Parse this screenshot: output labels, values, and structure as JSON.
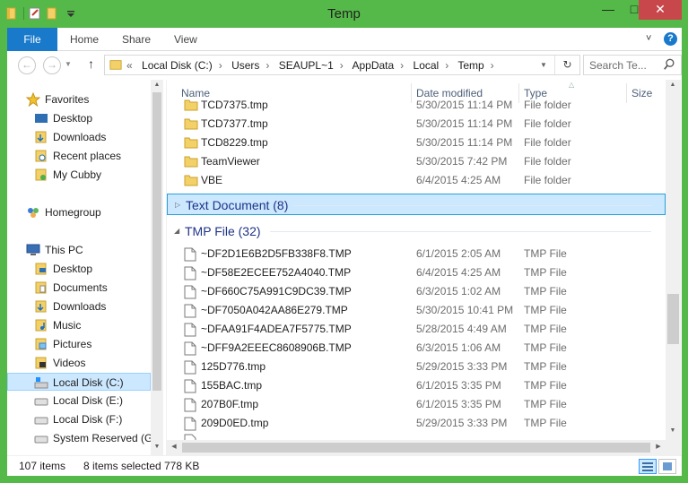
{
  "window": {
    "title": "Temp"
  },
  "ribbon": {
    "file": "File",
    "home": "Home",
    "share": "Share",
    "view": "View",
    "help": "?"
  },
  "address": {
    "crumbs": [
      "Local Disk (C:)",
      "Users",
      "SEAUPL~1",
      "AppData",
      "Local",
      "Temp"
    ],
    "search_placeholder": "Search Te..."
  },
  "nav": {
    "favorites": "Favorites",
    "desktop": "Desktop",
    "downloads": "Downloads",
    "recent": "Recent places",
    "cubby": "My Cubby",
    "homegroup": "Homegroup",
    "thispc": "This PC",
    "pc_desktop": "Desktop",
    "pc_documents": "Documents",
    "pc_downloads": "Downloads",
    "pc_music": "Music",
    "pc_pictures": "Pictures",
    "pc_videos": "Videos",
    "disk_c": "Local Disk (C:)",
    "disk_e": "Local Disk (E:)",
    "disk_f": "Local Disk (F:)",
    "sysres": "System Reserved (G:"
  },
  "columns": {
    "name": "Name",
    "date": "Date modified",
    "type": "Type",
    "size": "Size"
  },
  "folder_rows": [
    {
      "name": "TCD7375.tmp",
      "date": "5/30/2015 11:14 PM",
      "type": "File folder"
    },
    {
      "name": "TCD7377.tmp",
      "date": "5/30/2015 11:14 PM",
      "type": "File folder"
    },
    {
      "name": "TCD8229.tmp",
      "date": "5/30/2015 11:14 PM",
      "type": "File folder"
    },
    {
      "name": "TeamViewer",
      "date": "5/30/2015 7:42 PM",
      "type": "File folder"
    },
    {
      "name": "VBE",
      "date": "6/4/2015 4:25 AM",
      "type": "File folder"
    }
  ],
  "groups": {
    "text_doc": "Text Document (8)",
    "tmp_file": "TMP File (32)"
  },
  "tmp_rows": [
    {
      "name": "~DF2D1E6B2D5FB338F8.TMP",
      "date": "6/1/2015 2:05 AM",
      "type": "TMP File"
    },
    {
      "name": "~DF58E2ECEE752A4040.TMP",
      "date": "6/4/2015 4:25 AM",
      "type": "TMP File"
    },
    {
      "name": "~DF660C75A991C9DC39.TMP",
      "date": "6/3/2015 1:02 AM",
      "type": "TMP File"
    },
    {
      "name": "~DF7050A042AA86E279.TMP",
      "date": "5/30/2015 10:41 PM",
      "type": "TMP File"
    },
    {
      "name": "~DFAA91F4ADEA7F5775.TMP",
      "date": "5/28/2015 4:49 AM",
      "type": "TMP File"
    },
    {
      "name": "~DFF9A2EEEC8608906B.TMP",
      "date": "6/3/2015 1:06 AM",
      "type": "TMP File"
    },
    {
      "name": "125D776.tmp",
      "date": "5/29/2015 3:33 PM",
      "type": "TMP File"
    },
    {
      "name": "155BAC.tmp",
      "date": "6/1/2015 3:35 PM",
      "type": "TMP File"
    },
    {
      "name": "207B0F.tmp",
      "date": "6/1/2015 3:35 PM",
      "type": "TMP File"
    },
    {
      "name": "209D0ED.tmp",
      "date": "5/29/2015 3:33 PM",
      "type": "TMP File"
    }
  ],
  "status": {
    "count": "107 items",
    "selected": "8 items selected",
    "size": "778 KB"
  }
}
